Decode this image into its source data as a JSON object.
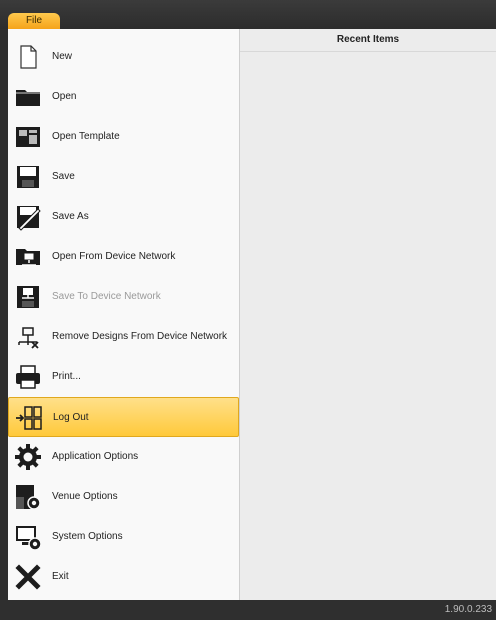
{
  "titlebar": {
    "file_tab": "File"
  },
  "menu": {
    "items": [
      {
        "label": "New",
        "icon": "new-document-icon"
      },
      {
        "label": "Open",
        "icon": "folder-open-icon"
      },
      {
        "label": "Open Template",
        "icon": "open-template-icon"
      },
      {
        "label": "Save",
        "icon": "save-icon"
      },
      {
        "label": "Save As",
        "icon": "save-as-icon"
      },
      {
        "label": "Open From Device Network",
        "icon": "open-from-network-icon"
      },
      {
        "label": "Save To Device Network",
        "icon": "save-to-network-icon",
        "disabled": true
      },
      {
        "label": "Remove Designs From Device Network",
        "icon": "remove-from-network-icon"
      },
      {
        "label": "Print...",
        "icon": "printer-icon"
      },
      {
        "label": "Log Out",
        "icon": "log-out-icon",
        "active": true
      },
      {
        "label": "Application Options",
        "icon": "gear-icon"
      },
      {
        "label": "Venue Options",
        "icon": "venue-options-icon"
      },
      {
        "label": "System Options",
        "icon": "system-options-icon"
      },
      {
        "label": "Exit",
        "icon": "close-icon"
      }
    ]
  },
  "recent": {
    "header": "Recent Items"
  },
  "status": {
    "version": "1.90.0.233"
  },
  "colors": {
    "accent": "#ffc93a",
    "accent_border": "#e0a81e",
    "frame": "#2e2e2e"
  }
}
